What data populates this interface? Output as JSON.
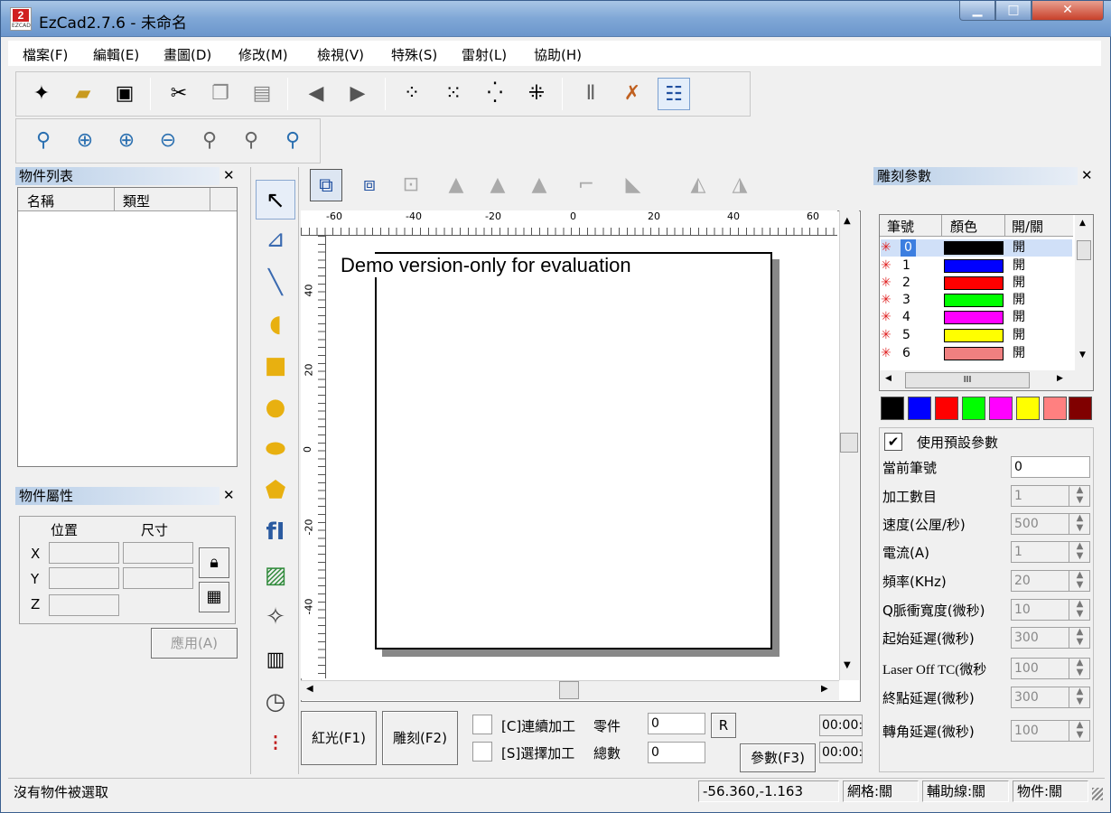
{
  "window": {
    "title": "EzCad2.7.6 - 未命名",
    "logo_text": "2",
    "logo_sub": "EZCAD"
  },
  "menu": [
    "檔案(F)",
    "編輯(E)",
    "畫圖(D)",
    "修改(M)",
    "檢視(V)",
    "特殊(S)",
    "雷射(L)",
    "協助(H)"
  ],
  "object_list": {
    "title": "物件列表",
    "col_name": "名稱",
    "col_type": "類型"
  },
  "object_props": {
    "title": "物件屬性",
    "pos_label": "位置",
    "size_label": "尺寸",
    "x_label": "X",
    "y_label": "Y",
    "z_label": "Z",
    "apply_label": "應用(A)"
  },
  "canvas": {
    "watermark": "Demo version-only for evaluation",
    "h_ticks": [
      "-60",
      "-40",
      "-20",
      "0",
      "20",
      "40",
      "60"
    ],
    "v_ticks": [
      "40",
      "20",
      "0",
      "-20",
      "-40"
    ]
  },
  "bottom_bar": {
    "red_light": "紅光(F1)",
    "mark": "雕刻(F2)",
    "continuous": "[C]連續加工",
    "select": "[S]選擇加工",
    "parts_label": "零件",
    "parts_value": "0",
    "total_label": "總數",
    "total_value": "0",
    "r_button": "R",
    "params_button": "參數(F3)",
    "time1": "00:00:",
    "time2": "00:00:"
  },
  "mark_params": {
    "title": "雕刻參數",
    "col_pen": "筆號",
    "col_color": "顏色",
    "col_onoff": "開/關",
    "pens": [
      {
        "no": "0",
        "color": "#000000",
        "state": "開"
      },
      {
        "no": "1",
        "color": "#0000ff",
        "state": "開"
      },
      {
        "no": "2",
        "color": "#ff0000",
        "state": "開"
      },
      {
        "no": "3",
        "color": "#00ff00",
        "state": "開"
      },
      {
        "no": "4",
        "color": "#ff00ff",
        "state": "開"
      },
      {
        "no": "5",
        "color": "#ffff00",
        "state": "開"
      },
      {
        "no": "6",
        "color": "#f08080",
        "state": "開"
      }
    ],
    "palette": [
      "#000000",
      "#0000ff",
      "#ff0000",
      "#00ff00",
      "#ff00ff",
      "#ffff00",
      "#ff8080",
      "#800000"
    ],
    "use_default": "使用預設參數",
    "rows": [
      {
        "label": "當前筆號",
        "value": "0"
      },
      {
        "label": "加工數目",
        "value": "1"
      },
      {
        "label": "速度(公厘/秒)",
        "value": "500"
      },
      {
        "label": "電流(A)",
        "value": "1"
      },
      {
        "label": "頻率(KHz)",
        "value": "20"
      },
      {
        "label": "Q脈衝寬度(微秒)",
        "value": "10"
      },
      {
        "label": "起始延遲(微秒)",
        "value": "300"
      },
      {
        "label": "Laser Off TC(微秒",
        "value": "100"
      },
      {
        "label": "終點延遲(微秒)",
        "value": "300"
      },
      {
        "label": "轉角延遲(微秒)",
        "value": "100"
      }
    ]
  },
  "status": {
    "message": "沒有物件被選取",
    "coords": "-56.360,-1.163",
    "grid": "網格:關",
    "guide": "輔助線:關",
    "object": "物件:關"
  }
}
